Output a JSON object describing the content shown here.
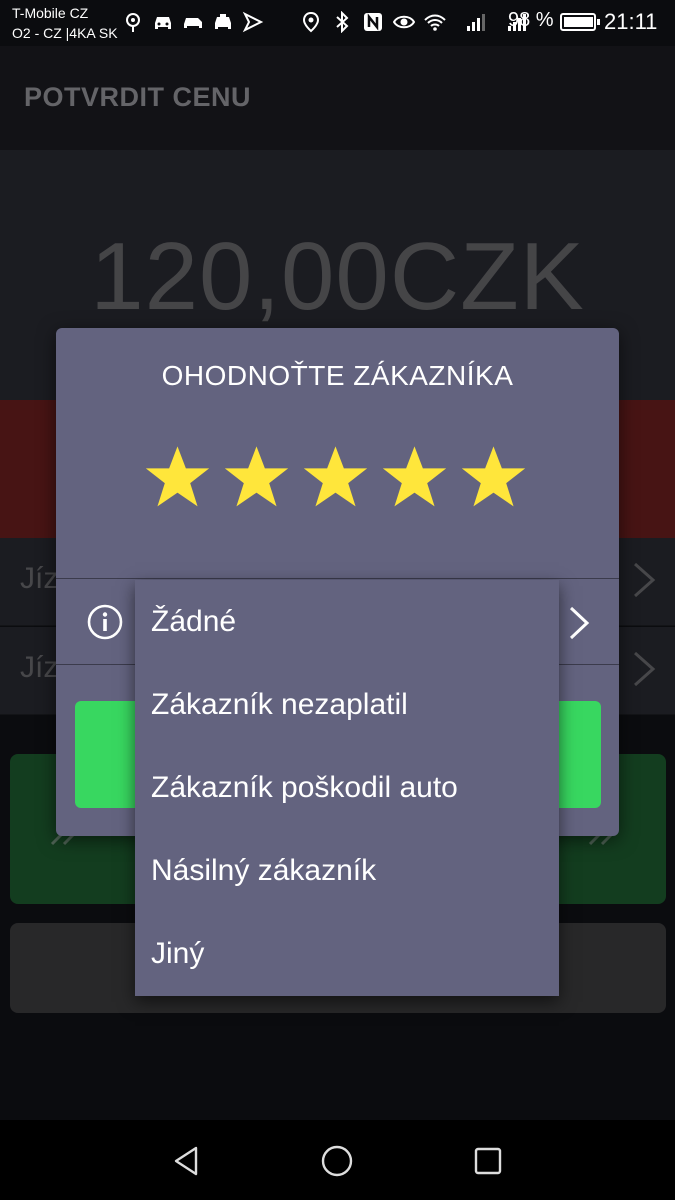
{
  "status_bar": {
    "carrier_1": "T-Mobile CZ",
    "carrier_2": "O2 - CZ |4KA SK",
    "left_icons": [
      "location-pin-icon",
      "car-icon",
      "car-icon",
      "car-icon",
      "navigation-icon"
    ],
    "right_icons": [
      "location-icon",
      "bluetooth-icon",
      "nfc-icon",
      "eye-icon",
      "wifi-icon",
      "signal-icon",
      "signal-icon"
    ],
    "battery_percent": "98 %",
    "battery_level": 0.98,
    "time": "21:11"
  },
  "app_bar": {
    "title": "POTVRDIT CENU"
  },
  "price": {
    "amount": "120,00CZK"
  },
  "background_rows": [
    {
      "label": "Jíz"
    },
    {
      "label": "Jíz"
    }
  ],
  "dialog": {
    "title": "OHODNOŤTE ZÁKAZNÍKA",
    "rating": 5,
    "rating_max": 5,
    "star_color": "#ffe63b",
    "selected_reason": "Žádné",
    "confirm_color": "#38d760"
  },
  "dropdown": {
    "items": [
      {
        "label": "Žádné"
      },
      {
        "label": "Zákazník nezaplatil"
      },
      {
        "label": "Zákazník poškodil auto"
      },
      {
        "label": "Násilný zákazník"
      },
      {
        "label": "Jiný"
      }
    ]
  },
  "nav_bar": {
    "icons": [
      "back-icon",
      "home-icon",
      "recents-icon"
    ]
  },
  "colors": {
    "dialog_bg": "#63637f",
    "red_band": "#6e2020",
    "green_button": "#1e5e30"
  }
}
